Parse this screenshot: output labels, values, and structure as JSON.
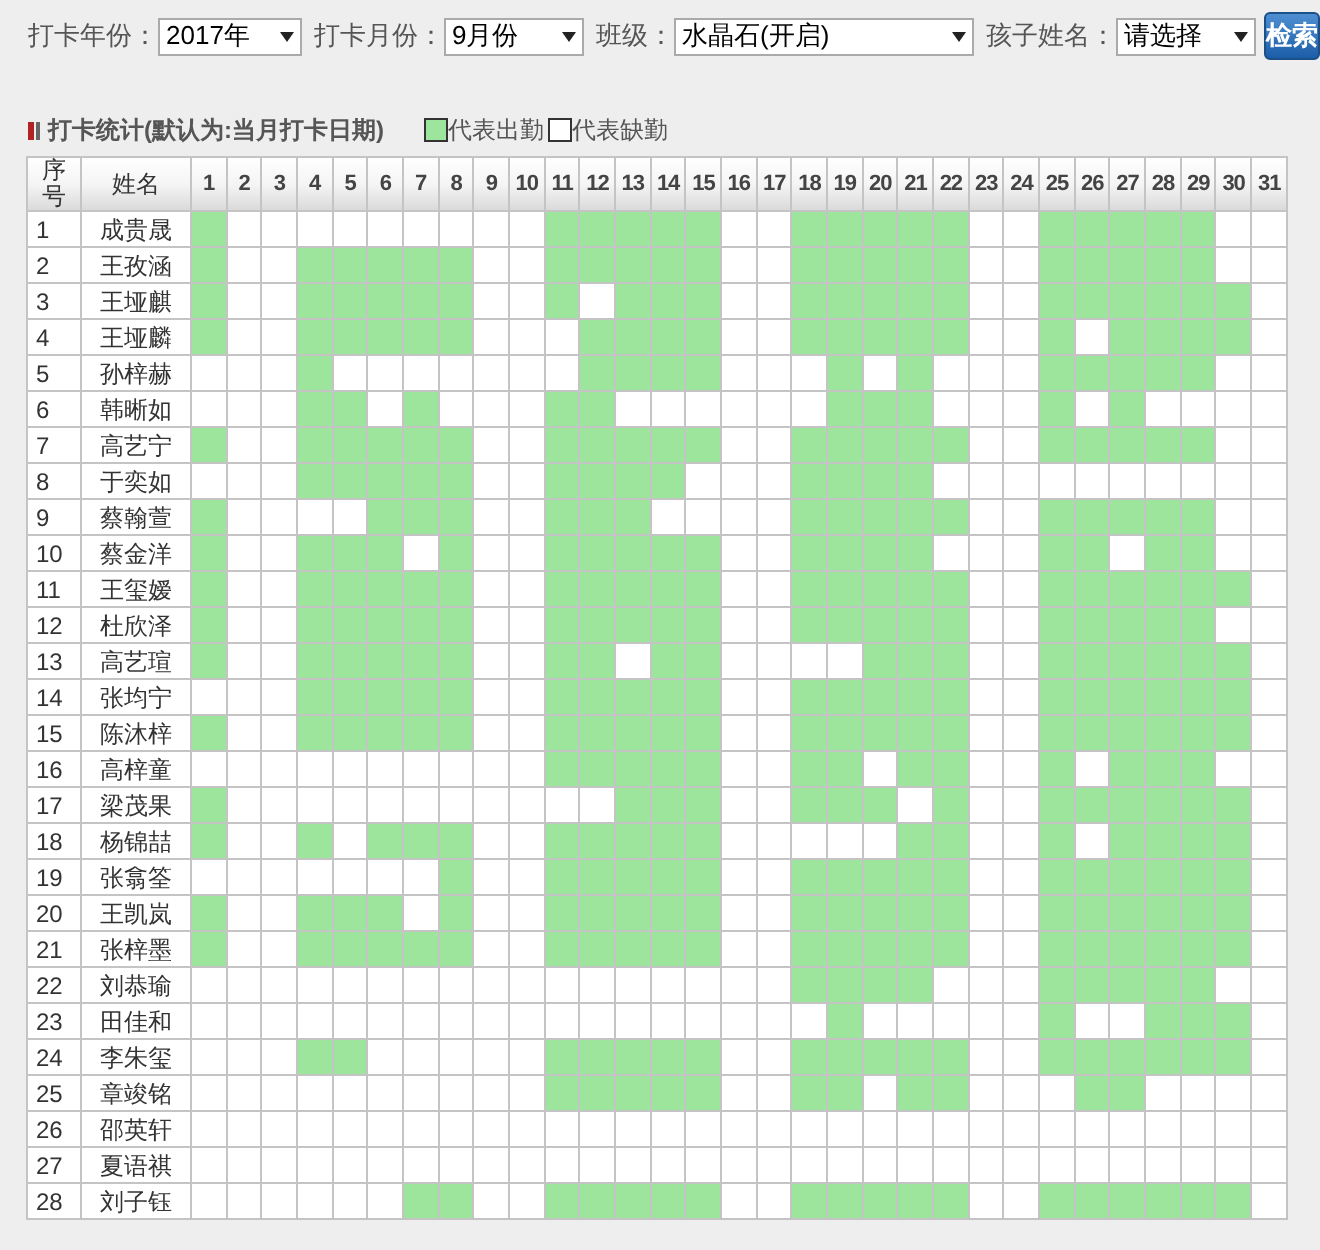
{
  "filters": [
    {
      "label": "打卡年份：",
      "value": "2017年",
      "kind": "small"
    },
    {
      "label": "打卡月份：",
      "value": "9月份",
      "kind": "small"
    },
    {
      "label": "班级：",
      "value": "水晶石(开启)",
      "kind": "wide"
    },
    {
      "label": "孩子姓名：",
      "value": "请选择",
      "kind": "small"
    }
  ],
  "search_button": "检索",
  "section_title": "打卡统计(默认为:当月打卡日期)",
  "legend": [
    {
      "label": "代表出勤",
      "present": true
    },
    {
      "label": "代表缺勤",
      "present": false
    }
  ],
  "table": {
    "columns": [
      "序号",
      "姓名"
    ],
    "days": [
      "1",
      "2",
      "3",
      "4",
      "5",
      "6",
      "7",
      "8",
      "9",
      "10",
      "11",
      "12",
      "13",
      "14",
      "15",
      "16",
      "17",
      "18",
      "19",
      "20",
      "21",
      "22",
      "23",
      "24",
      "25",
      "26",
      "27",
      "28",
      "29",
      "30",
      "31"
    ],
    "rows": [
      {
        "no": "1",
        "name": "成贵晟",
        "attendance": [
          true,
          false,
          false,
          false,
          false,
          false,
          false,
          false,
          false,
          false,
          true,
          true,
          true,
          true,
          true,
          false,
          false,
          true,
          true,
          true,
          true,
          true,
          false,
          false,
          true,
          true,
          true,
          true,
          true,
          false,
          false
        ]
      },
      {
        "no": "2",
        "name": "王孜涵",
        "attendance": [
          true,
          false,
          false,
          true,
          true,
          true,
          true,
          true,
          false,
          false,
          true,
          true,
          true,
          true,
          true,
          false,
          false,
          true,
          true,
          true,
          true,
          true,
          false,
          false,
          true,
          true,
          true,
          true,
          true,
          false,
          false
        ]
      },
      {
        "no": "3",
        "name": "王垭麒",
        "attendance": [
          true,
          false,
          false,
          true,
          true,
          true,
          true,
          true,
          false,
          false,
          true,
          false,
          true,
          true,
          true,
          false,
          false,
          true,
          true,
          true,
          true,
          true,
          false,
          false,
          true,
          true,
          true,
          true,
          true,
          true,
          false
        ]
      },
      {
        "no": "4",
        "name": "王垭麟",
        "attendance": [
          true,
          false,
          false,
          true,
          true,
          true,
          true,
          true,
          false,
          false,
          false,
          true,
          true,
          true,
          true,
          false,
          false,
          true,
          true,
          true,
          true,
          true,
          false,
          false,
          true,
          false,
          true,
          true,
          true,
          true,
          false
        ]
      },
      {
        "no": "5",
        "name": "孙梓赫",
        "attendance": [
          false,
          false,
          false,
          true,
          false,
          false,
          false,
          false,
          false,
          false,
          false,
          true,
          true,
          true,
          true,
          false,
          false,
          false,
          true,
          false,
          true,
          false,
          false,
          false,
          true,
          true,
          true,
          true,
          true,
          false,
          false
        ]
      },
      {
        "no": "6",
        "name": "韩晰如",
        "attendance": [
          false,
          false,
          false,
          true,
          true,
          false,
          true,
          false,
          false,
          false,
          true,
          true,
          false,
          false,
          false,
          false,
          false,
          false,
          true,
          true,
          true,
          false,
          false,
          false,
          true,
          false,
          true,
          false,
          false,
          false,
          false
        ]
      },
      {
        "no": "7",
        "name": "高艺宁",
        "attendance": [
          true,
          false,
          false,
          true,
          true,
          true,
          true,
          true,
          false,
          false,
          true,
          true,
          true,
          true,
          true,
          false,
          false,
          true,
          true,
          true,
          true,
          true,
          false,
          false,
          true,
          true,
          true,
          true,
          true,
          false,
          false
        ]
      },
      {
        "no": "8",
        "name": "于奕如",
        "attendance": [
          false,
          false,
          false,
          true,
          true,
          true,
          true,
          true,
          false,
          false,
          true,
          true,
          true,
          true,
          false,
          false,
          false,
          true,
          true,
          true,
          true,
          false,
          false,
          false,
          false,
          false,
          false,
          false,
          false,
          false,
          false
        ]
      },
      {
        "no": "9",
        "name": "蔡翰萱",
        "attendance": [
          true,
          false,
          false,
          false,
          false,
          true,
          true,
          true,
          false,
          false,
          true,
          true,
          true,
          false,
          false,
          false,
          false,
          true,
          true,
          true,
          true,
          true,
          false,
          false,
          true,
          true,
          true,
          true,
          true,
          false,
          false
        ]
      },
      {
        "no": "10",
        "name": "蔡金洋",
        "attendance": [
          true,
          false,
          false,
          true,
          true,
          true,
          false,
          true,
          false,
          false,
          true,
          true,
          true,
          true,
          true,
          false,
          false,
          true,
          true,
          true,
          true,
          false,
          false,
          false,
          true,
          true,
          false,
          true,
          true,
          false,
          false
        ]
      },
      {
        "no": "11",
        "name": "王玺嫒",
        "attendance": [
          true,
          false,
          false,
          true,
          true,
          true,
          true,
          true,
          false,
          false,
          true,
          true,
          true,
          true,
          true,
          false,
          false,
          true,
          true,
          true,
          true,
          true,
          false,
          false,
          true,
          true,
          true,
          true,
          true,
          true,
          false
        ]
      },
      {
        "no": "12",
        "name": "杜欣泽",
        "attendance": [
          true,
          false,
          false,
          true,
          true,
          true,
          true,
          true,
          false,
          false,
          true,
          true,
          true,
          true,
          true,
          false,
          false,
          true,
          true,
          true,
          true,
          true,
          false,
          false,
          true,
          true,
          true,
          true,
          true,
          false,
          false
        ]
      },
      {
        "no": "13",
        "name": "高艺瑄",
        "attendance": [
          true,
          false,
          false,
          true,
          true,
          true,
          true,
          true,
          false,
          false,
          true,
          true,
          false,
          true,
          true,
          false,
          false,
          false,
          false,
          true,
          true,
          true,
          false,
          false,
          true,
          true,
          true,
          true,
          true,
          true,
          false
        ]
      },
      {
        "no": "14",
        "name": "张均宁",
        "attendance": [
          false,
          false,
          false,
          true,
          true,
          true,
          true,
          true,
          false,
          false,
          true,
          true,
          true,
          true,
          true,
          false,
          false,
          true,
          true,
          true,
          true,
          true,
          false,
          false,
          true,
          true,
          true,
          true,
          true,
          true,
          false
        ]
      },
      {
        "no": "15",
        "name": "陈沐梓",
        "attendance": [
          true,
          false,
          false,
          true,
          true,
          true,
          true,
          true,
          false,
          false,
          true,
          true,
          true,
          true,
          true,
          false,
          false,
          true,
          true,
          true,
          true,
          true,
          false,
          false,
          true,
          true,
          true,
          true,
          true,
          true,
          false
        ]
      },
      {
        "no": "16",
        "name": "高梓童",
        "attendance": [
          false,
          false,
          false,
          false,
          false,
          false,
          false,
          false,
          false,
          false,
          true,
          true,
          true,
          true,
          true,
          false,
          false,
          true,
          true,
          false,
          true,
          true,
          false,
          false,
          true,
          false,
          true,
          true,
          true,
          false,
          false
        ]
      },
      {
        "no": "17",
        "name": "梁茂果",
        "attendance": [
          true,
          false,
          false,
          false,
          false,
          false,
          false,
          false,
          false,
          false,
          false,
          false,
          true,
          true,
          true,
          false,
          false,
          true,
          true,
          true,
          false,
          true,
          false,
          false,
          true,
          true,
          true,
          true,
          true,
          true,
          false
        ]
      },
      {
        "no": "18",
        "name": "杨锦喆",
        "attendance": [
          true,
          false,
          false,
          true,
          false,
          true,
          true,
          true,
          false,
          false,
          true,
          true,
          true,
          true,
          true,
          false,
          false,
          false,
          false,
          false,
          true,
          true,
          false,
          false,
          true,
          false,
          true,
          true,
          true,
          true,
          false
        ]
      },
      {
        "no": "19",
        "name": "张翕筌",
        "attendance": [
          false,
          false,
          false,
          false,
          false,
          false,
          false,
          true,
          false,
          false,
          true,
          true,
          true,
          true,
          true,
          false,
          false,
          true,
          true,
          true,
          true,
          true,
          false,
          false,
          true,
          true,
          true,
          true,
          true,
          true,
          false
        ]
      },
      {
        "no": "20",
        "name": "王凯岚",
        "attendance": [
          true,
          false,
          false,
          true,
          true,
          true,
          false,
          true,
          false,
          false,
          true,
          true,
          true,
          true,
          true,
          false,
          false,
          true,
          true,
          true,
          true,
          true,
          false,
          false,
          true,
          true,
          true,
          true,
          true,
          true,
          false
        ]
      },
      {
        "no": "21",
        "name": "张梓墨",
        "attendance": [
          true,
          false,
          false,
          true,
          true,
          true,
          true,
          true,
          false,
          false,
          true,
          true,
          true,
          true,
          true,
          false,
          false,
          true,
          true,
          true,
          true,
          true,
          false,
          false,
          true,
          true,
          true,
          true,
          true,
          true,
          false
        ]
      },
      {
        "no": "22",
        "name": "刘恭瑜",
        "attendance": [
          false,
          false,
          false,
          false,
          false,
          false,
          false,
          false,
          false,
          false,
          false,
          false,
          false,
          false,
          false,
          false,
          false,
          true,
          true,
          true,
          true,
          false,
          false,
          false,
          true,
          true,
          true,
          true,
          true,
          false,
          false
        ]
      },
      {
        "no": "23",
        "name": "田佳和",
        "attendance": [
          false,
          false,
          false,
          false,
          false,
          false,
          false,
          false,
          false,
          false,
          false,
          false,
          false,
          false,
          false,
          false,
          false,
          false,
          true,
          false,
          false,
          false,
          false,
          false,
          true,
          false,
          false,
          true,
          true,
          true,
          false
        ]
      },
      {
        "no": "24",
        "name": "李朱玺",
        "attendance": [
          false,
          false,
          false,
          true,
          true,
          false,
          false,
          false,
          false,
          false,
          true,
          true,
          true,
          true,
          true,
          false,
          false,
          true,
          true,
          true,
          true,
          true,
          false,
          false,
          true,
          true,
          true,
          true,
          true,
          true,
          false
        ]
      },
      {
        "no": "25",
        "name": "章竣铭",
        "attendance": [
          false,
          false,
          false,
          false,
          false,
          false,
          false,
          false,
          false,
          false,
          true,
          true,
          true,
          true,
          true,
          false,
          false,
          true,
          true,
          false,
          true,
          true,
          false,
          false,
          false,
          true,
          true,
          false,
          false,
          false,
          false
        ]
      },
      {
        "no": "26",
        "name": "邵英轩",
        "attendance": [
          false,
          false,
          false,
          false,
          false,
          false,
          false,
          false,
          false,
          false,
          false,
          false,
          false,
          false,
          false,
          false,
          false,
          false,
          false,
          false,
          false,
          false,
          false,
          false,
          false,
          false,
          false,
          false,
          false,
          false,
          false
        ]
      },
      {
        "no": "27",
        "name": "夏语祺",
        "attendance": [
          false,
          false,
          false,
          false,
          false,
          false,
          false,
          false,
          false,
          false,
          false,
          false,
          false,
          false,
          false,
          false,
          false,
          false,
          false,
          false,
          false,
          false,
          false,
          false,
          false,
          false,
          false,
          false,
          false,
          false,
          false
        ]
      },
      {
        "no": "28",
        "name": "刘子钰",
        "attendance": [
          false,
          false,
          false,
          false,
          false,
          false,
          true,
          true,
          false,
          false,
          true,
          true,
          true,
          true,
          true,
          false,
          false,
          true,
          true,
          true,
          true,
          true,
          false,
          false,
          true,
          true,
          true,
          true,
          true,
          true,
          false
        ]
      }
    ]
  }
}
